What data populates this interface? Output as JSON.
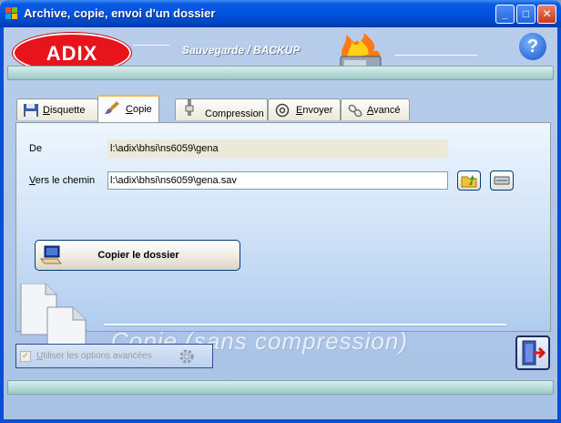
{
  "window": {
    "title": "Archive, copie, envoi d'un dossier",
    "minimize": "_",
    "maximize": "□",
    "close": "✕"
  },
  "header": {
    "logo_text": "ADIX",
    "title": "Sauvegarde / BACKUP",
    "help": "?"
  },
  "tabs": [
    {
      "label": "Disquette",
      "underline": "D",
      "rest": "isquette",
      "icon": "floppy-disk-icon",
      "active": false
    },
    {
      "label": "Copie",
      "underline": "C",
      "rest": "opie",
      "icon": "brush-icon",
      "active": true
    },
    {
      "label": "Compression",
      "underline": "",
      "rest": "Compression",
      "icon": "compress-icon",
      "active": false
    },
    {
      "label": "Envoyer",
      "underline": "E",
      "rest": "nvoyer",
      "icon": "at-sign-icon",
      "active": false
    },
    {
      "label": "Avancé",
      "underline": "A",
      "rest": "vancé",
      "icon": "chain-icon",
      "active": false
    }
  ],
  "form": {
    "source_label": "De",
    "source_value": "l:\\adix\\bhsi\\ns6059\\gena",
    "dest_label_u": "V",
    "dest_label_rest": "ers le chemin",
    "dest_value": "l:\\adix\\bhsi\\ns6059\\gena.sav"
  },
  "actions": {
    "copy_folder": "Copier le dossier"
  },
  "watermark": "Copie   (sans compression)",
  "advanced": {
    "checked": true,
    "label_u": "U",
    "label_rest": "tiliser les options avancées"
  },
  "colors": {
    "accent_tab": "#f5b53f",
    "logo_red": "#e8141c",
    "titlebar_blue": "#0054e3"
  }
}
